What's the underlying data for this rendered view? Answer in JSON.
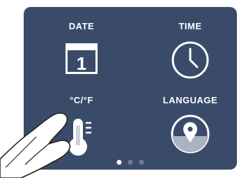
{
  "screen": {
    "background": "#3a4b6a",
    "accent": "#ffffff",
    "muted": "#6f7c94"
  },
  "tiles": [
    {
      "label": "DATE",
      "icon": "calendar-icon",
      "calendar_day": "1"
    },
    {
      "label": "TIME",
      "icon": "clock-icon"
    },
    {
      "label": "°C/°F",
      "icon": "thermometer-icon"
    },
    {
      "label": "LANGUAGE",
      "icon": "location-pin-icon"
    }
  ],
  "pagination": {
    "total": 3,
    "active": 1
  },
  "overlay": {
    "icon": "pointing-hand-icon"
  }
}
